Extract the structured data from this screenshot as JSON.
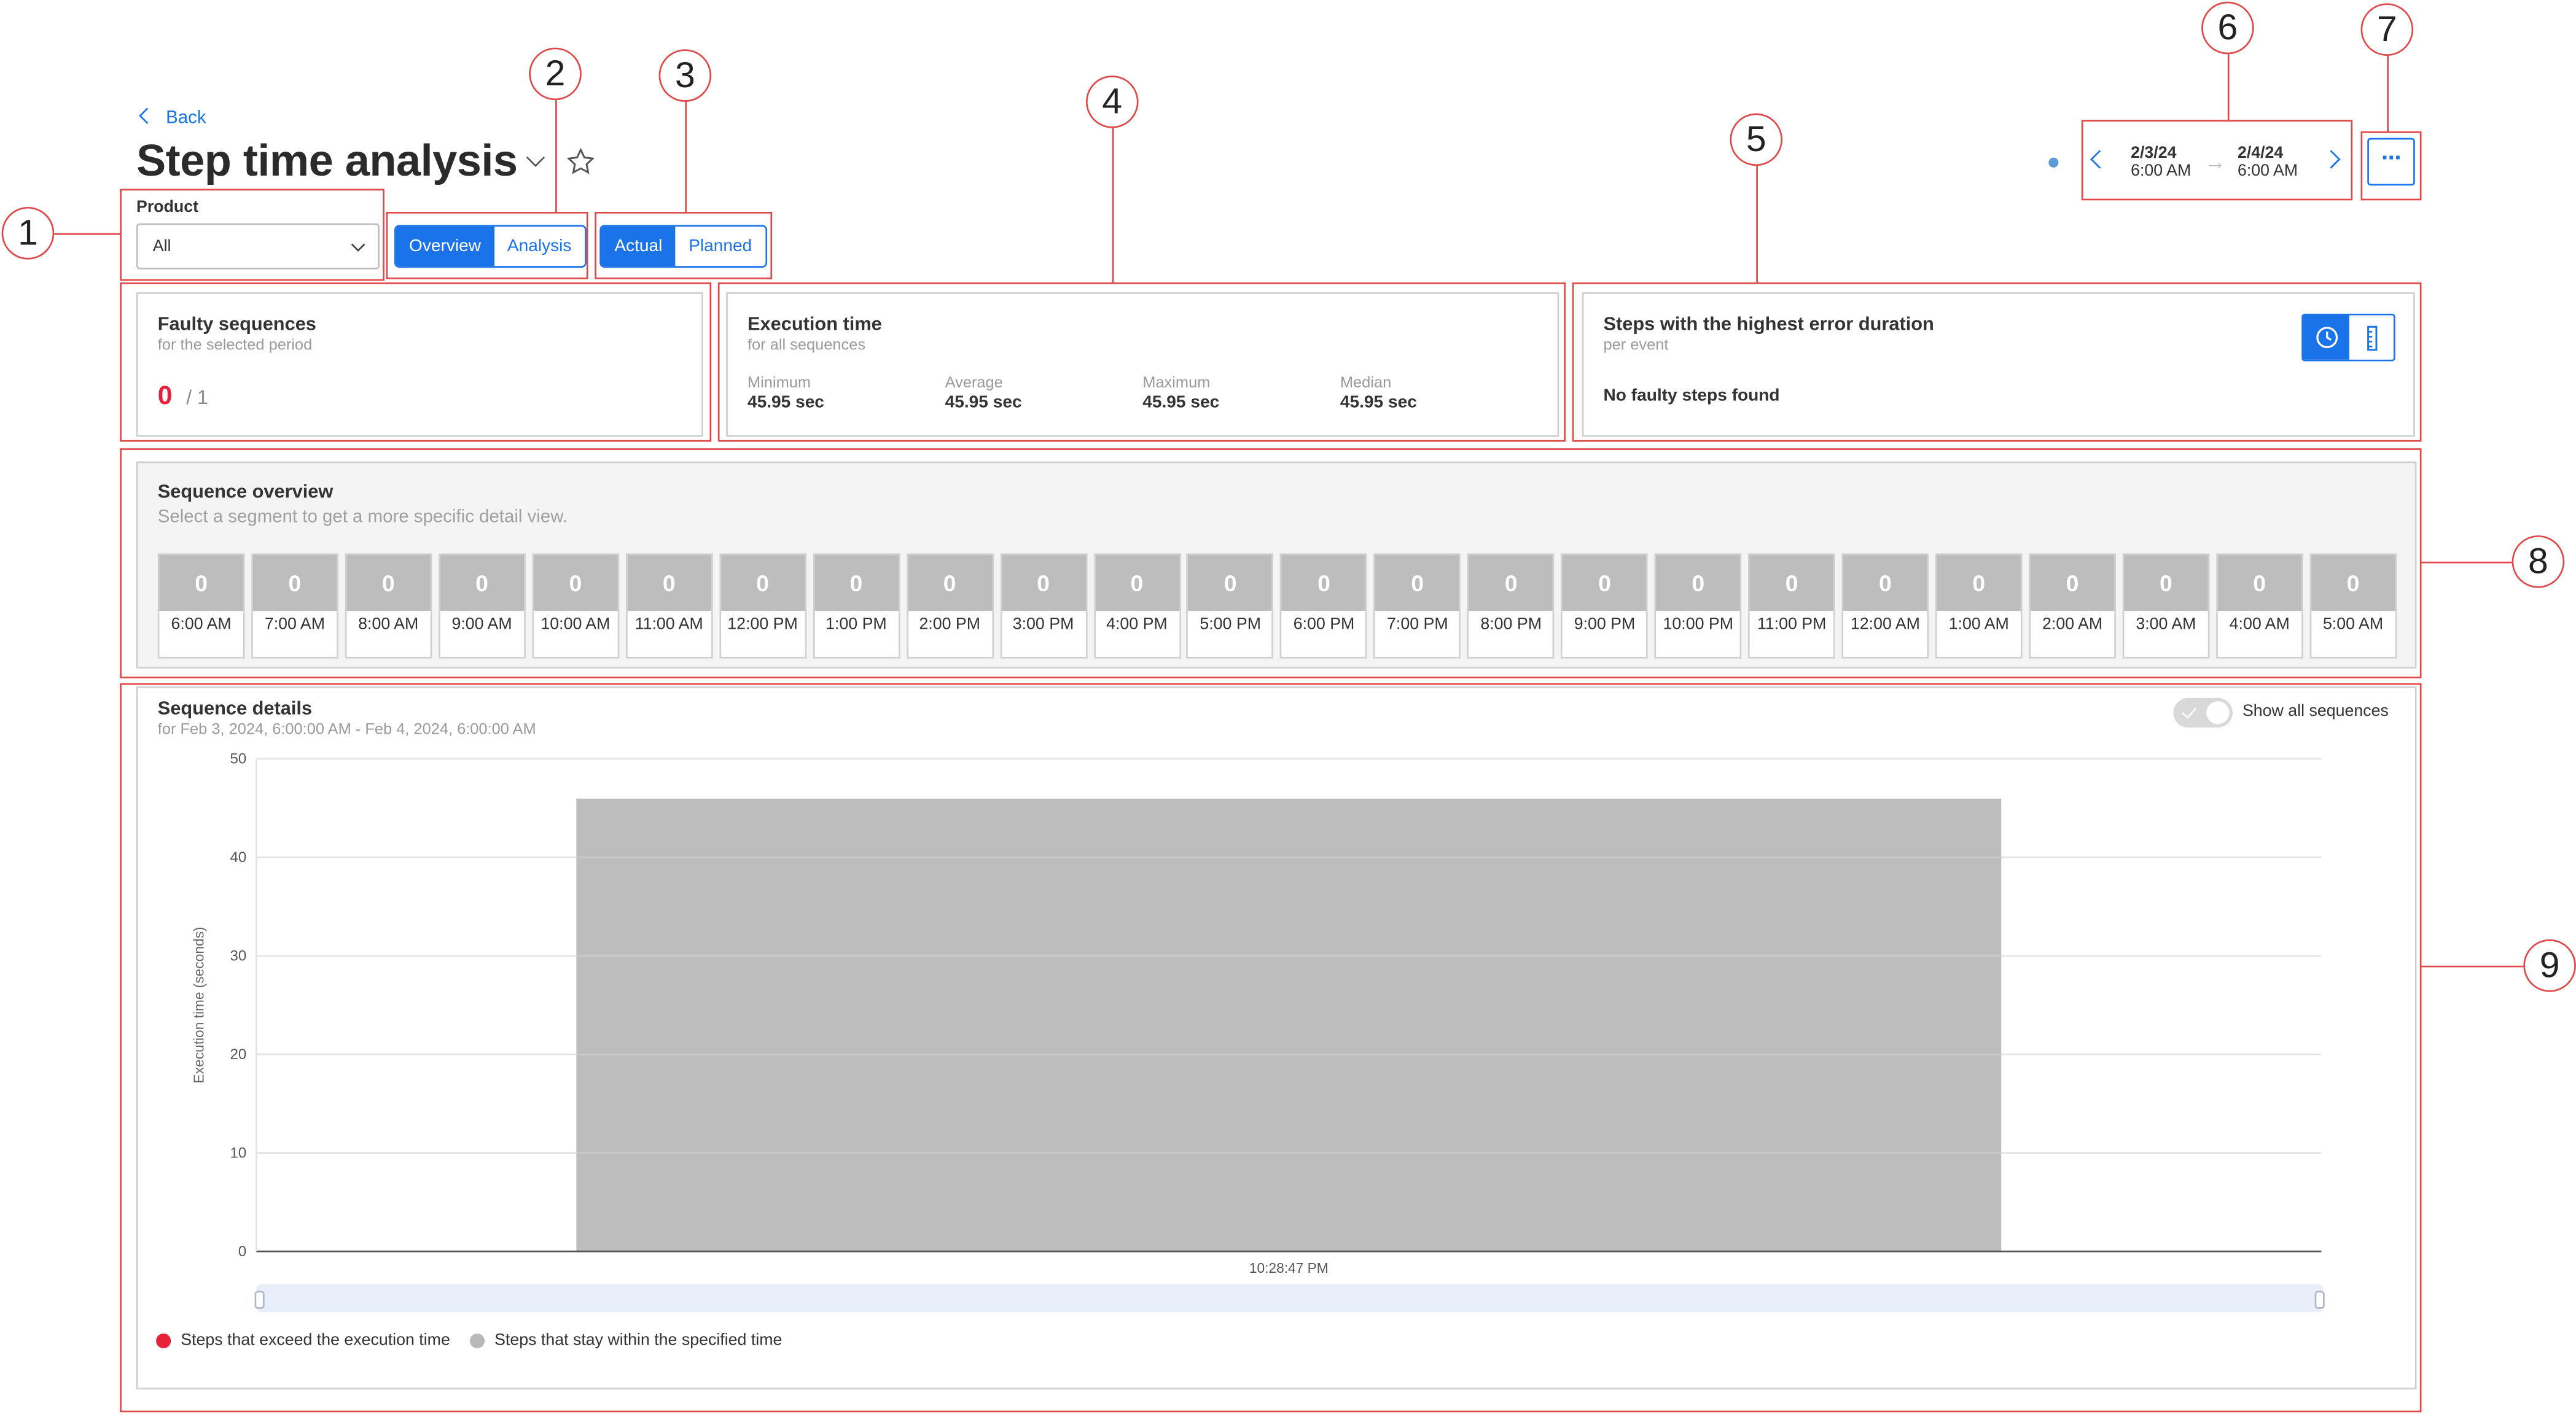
{
  "header": {
    "back_label": "Back",
    "title": "Step time analysis",
    "product_label": "Product",
    "product_value": "All",
    "view_tabs": [
      "Overview",
      "Analysis"
    ],
    "mode_tabs": [
      "Actual",
      "Planned"
    ],
    "range_start_date": "2/3/24",
    "range_start_time": "6:00 AM",
    "range_end_date": "2/4/24",
    "range_end_time": "6:00 AM",
    "more_label": "···"
  },
  "faulty": {
    "title": "Faulty sequences",
    "subtitle": "for the selected period",
    "count": "0",
    "total": "/ 1"
  },
  "execution": {
    "title": "Execution time",
    "subtitle": "for all sequences",
    "stats": [
      {
        "label": "Minimum",
        "value": "45.95 sec"
      },
      {
        "label": "Average",
        "value": "45.95 sec"
      },
      {
        "label": "Maximum",
        "value": "45.95 sec"
      },
      {
        "label": "Median",
        "value": "45.95 sec"
      }
    ]
  },
  "errors": {
    "title": "Steps with the highest error duration",
    "subtitle": "per event",
    "empty": "No faulty steps found"
  },
  "overview": {
    "title": "Sequence overview",
    "subtitle": "Select a segment to get a more specific detail view.",
    "segments": [
      {
        "value": "0",
        "time": "6:00 AM"
      },
      {
        "value": "0",
        "time": "7:00 AM"
      },
      {
        "value": "0",
        "time": "8:00 AM"
      },
      {
        "value": "0",
        "time": "9:00 AM"
      },
      {
        "value": "0",
        "time": "10:00 AM"
      },
      {
        "value": "0",
        "time": "11:00 AM"
      },
      {
        "value": "0",
        "time": "12:00 PM"
      },
      {
        "value": "0",
        "time": "1:00 PM"
      },
      {
        "value": "0",
        "time": "2:00 PM"
      },
      {
        "value": "0",
        "time": "3:00 PM"
      },
      {
        "value": "0",
        "time": "4:00 PM"
      },
      {
        "value": "0",
        "time": "5:00 PM"
      },
      {
        "value": "0",
        "time": "6:00 PM"
      },
      {
        "value": "0",
        "time": "7:00 PM"
      },
      {
        "value": "0",
        "time": "8:00 PM"
      },
      {
        "value": "0",
        "time": "9:00 PM"
      },
      {
        "value": "0",
        "time": "10:00 PM"
      },
      {
        "value": "0",
        "time": "11:00 PM"
      },
      {
        "value": "0",
        "time": "12:00 AM"
      },
      {
        "value": "0",
        "time": "1:00 AM"
      },
      {
        "value": "0",
        "time": "2:00 AM"
      },
      {
        "value": "0",
        "time": "3:00 AM"
      },
      {
        "value": "0",
        "time": "4:00 AM"
      },
      {
        "value": "0",
        "time": "5:00 AM"
      }
    ]
  },
  "details": {
    "title": "Sequence details",
    "subtitle": "for Feb 3, 2024, 6:00:00 AM - Feb 4, 2024, 6:00:00 AM",
    "toggle_label": "Show all sequences",
    "legend": [
      {
        "label": "Steps that exceed the execution time",
        "color": "#e8213a"
      },
      {
        "label": "Steps that stay within the specified time",
        "color": "#b9b9b9"
      }
    ]
  },
  "chart_data": {
    "type": "bar",
    "categories": [
      "10:28:47 PM"
    ],
    "values": [
      45.95
    ],
    "ylabel": "Execution time (seconds)",
    "ylim": [
      0,
      50
    ],
    "yticks": [
      0,
      10,
      20,
      30,
      40,
      50
    ],
    "grid": true
  },
  "annotations": [
    "1",
    "2",
    "3",
    "4",
    "5",
    "6",
    "7",
    "8",
    "9"
  ],
  "colors": {
    "accent": "#1a73e8",
    "annotation": "#e04848",
    "fault": "#e8213a"
  }
}
